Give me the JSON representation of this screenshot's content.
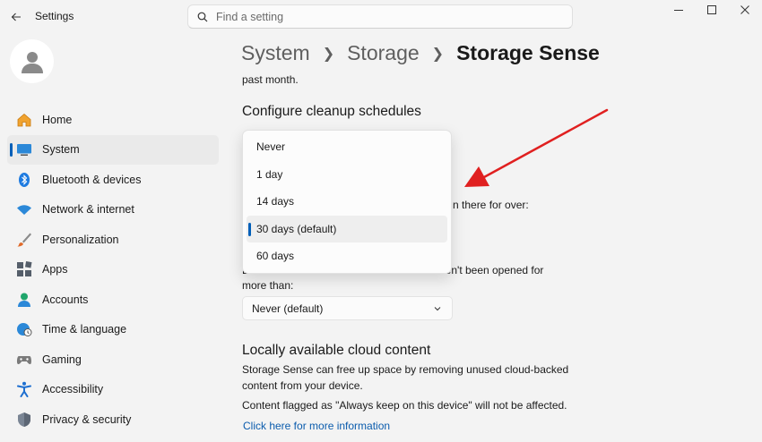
{
  "app": {
    "title": "Settings",
    "search_placeholder": "Find a setting"
  },
  "sidebar": {
    "items": [
      {
        "label": "Home",
        "icon": "home-icon"
      },
      {
        "label": "System",
        "icon": "system-icon",
        "selected": true
      },
      {
        "label": "Bluetooth & devices",
        "icon": "bluetooth-icon"
      },
      {
        "label": "Network & internet",
        "icon": "network-icon"
      },
      {
        "label": "Personalization",
        "icon": "brush-icon"
      },
      {
        "label": "Apps",
        "icon": "apps-icon"
      },
      {
        "label": "Accounts",
        "icon": "accounts-icon"
      },
      {
        "label": "Time & language",
        "icon": "globe-icon"
      },
      {
        "label": "Gaming",
        "icon": "gamepad-icon"
      },
      {
        "label": "Accessibility",
        "icon": "accessibility-icon"
      },
      {
        "label": "Privacy & security",
        "icon": "shield-icon"
      }
    ]
  },
  "breadcrumb": {
    "items": [
      "System",
      "Storage"
    ],
    "current": "Storage Sense"
  },
  "main": {
    "top_text": "past month.",
    "cleanup_heading": "Configure cleanup schedules",
    "partial_recycle_text": "n there for over:",
    "downloads_partial_left": "D",
    "downloads_partial_right": "aven't been opened for",
    "downloads_text_line2": "more than:",
    "downloads_select_value": "Never (default)",
    "cloud_heading": "Locally available cloud content",
    "cloud_text_line1": "Storage Sense can free up space by removing unused cloud-backed",
    "cloud_text_line2": "content from your device.",
    "cloud_flag_text": "Content flagged as \"Always keep on this device\" will not be affected.",
    "more_info_link": "Click here for more information"
  },
  "dropdown": {
    "options": [
      "Never",
      "1 day",
      "14 days",
      "30 days (default)",
      "60 days"
    ],
    "selected": "30 days (default)"
  },
  "colors": {
    "accent": "#005fb8",
    "annotation_arrow": "#e02020",
    "link": "#0b5cad"
  }
}
